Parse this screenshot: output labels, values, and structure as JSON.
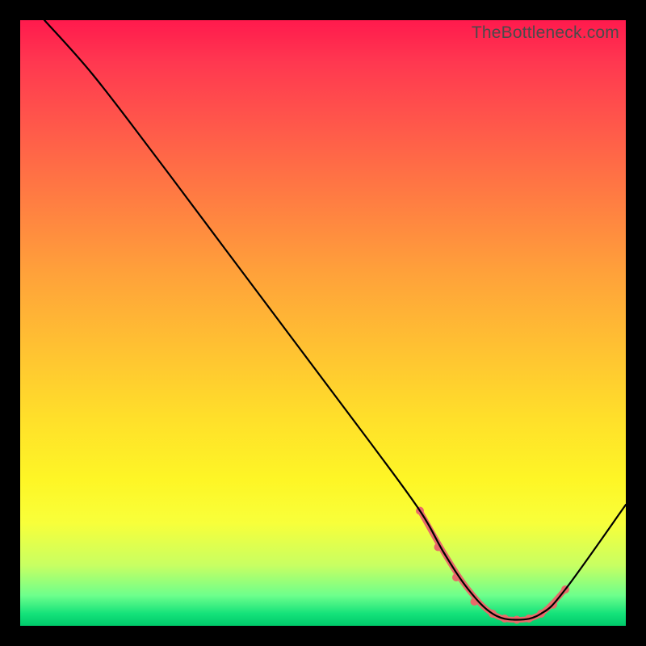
{
  "watermark": "TheBottleneck.com",
  "chart_data": {
    "type": "line",
    "title": "",
    "xlabel": "",
    "ylabel": "",
    "xlim": [
      0,
      100
    ],
    "ylim": [
      0,
      100
    ],
    "series": [
      {
        "name": "main-curve",
        "color": "#000000",
        "width": 2.2,
        "x": [
          4,
          12,
          22,
          34,
          46,
          58,
          66,
          70,
          74,
          78,
          82,
          86,
          90,
          100
        ],
        "y": [
          100,
          91,
          78,
          62,
          46,
          30,
          19,
          12,
          6,
          2,
          1,
          2,
          6,
          20
        ]
      },
      {
        "name": "highlight-segment",
        "color": "#e86a6a",
        "width": 7,
        "x": [
          66,
          70,
          74,
          78,
          82,
          86,
          90
        ],
        "y": [
          19,
          12,
          6,
          2,
          1,
          2,
          6
        ]
      }
    ],
    "highlight_points": {
      "color": "#e86a6a",
      "radius": 5,
      "x": [
        66,
        69,
        72,
        75,
        78,
        80,
        82,
        84,
        86,
        88,
        90
      ],
      "y": [
        19,
        13,
        8,
        4,
        2,
        1.2,
        1,
        1.2,
        2,
        3.5,
        6
      ]
    }
  }
}
